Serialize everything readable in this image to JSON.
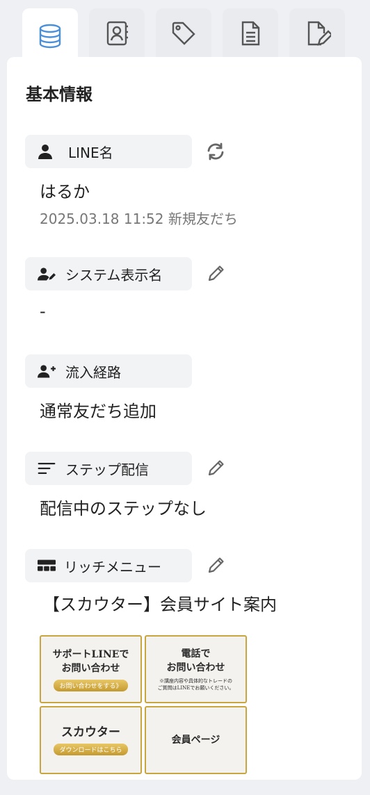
{
  "tabs": [
    {
      "icon": "database-icon",
      "active": true
    },
    {
      "icon": "contact-book-icon",
      "active": false
    },
    {
      "icon": "tag-icon",
      "active": false
    },
    {
      "icon": "document-icon",
      "active": false
    },
    {
      "icon": "file-edit-icon",
      "active": false
    }
  ],
  "panel": {
    "title": "基本情報",
    "line_name": {
      "label": "LINE名",
      "value": "はるか",
      "sub": "2025.03.18 11:52 新規友だち"
    },
    "system_name": {
      "label": "システム表示名",
      "value": "-"
    },
    "inflow": {
      "label": "流入経路",
      "value": "通常友だち追加"
    },
    "step": {
      "label": "ステップ配信",
      "value": "配信中のステップなし"
    },
    "rich_menu": {
      "label": "リッチメニュー",
      "value": "【スカウター】会員サイト案内",
      "cells": [
        {
          "text": "サポートLINEで\nお問い合わせ",
          "button": "お問い合わせをする》",
          "note": ""
        },
        {
          "text": "電話で\nお問い合わせ",
          "button": "",
          "note": "※講座内容や具体的なトレードの\nご質問はLINEでお願いください。"
        },
        {
          "text": "スカウター",
          "button": "ダウンロードはこちら",
          "note": ""
        },
        {
          "text": "会員ページ",
          "button": "",
          "note": ""
        }
      ]
    }
  },
  "colors": {
    "accent": "#4a90d9",
    "gold": "#c9a540",
    "label_bg": "#f2f3f5"
  }
}
